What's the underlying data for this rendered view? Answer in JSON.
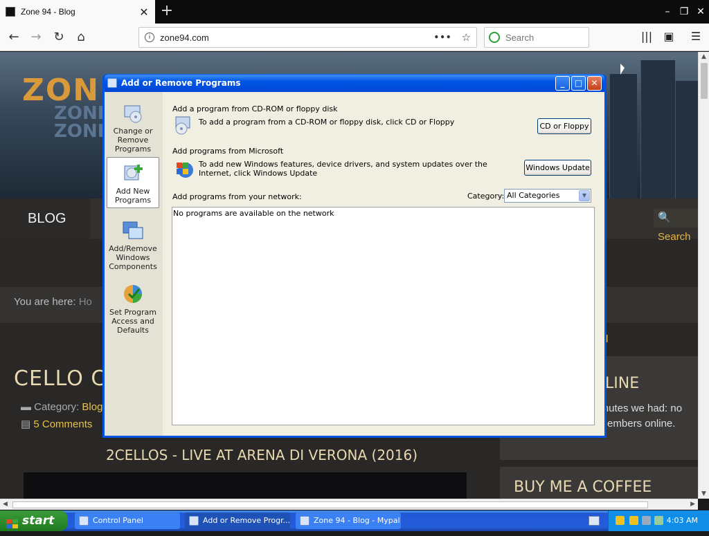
{
  "browser": {
    "tab_title": "Zone 94 - Blog",
    "url": "zone94.com",
    "search_placeholder": "Search"
  },
  "webpage": {
    "nav_blog": "BLOG",
    "nav_search": "Search",
    "breadcrumb_label": "You are here:",
    "breadcrumb_home": "Ho",
    "post_title": "CELLO CR",
    "category_label": "Category:",
    "category_link": "Blog",
    "comments": "5 Comments",
    "subheading": "2CELLOS - LIVE AT ARENA DI VERONA (2016)",
    "sidebar_fragment": "d",
    "sidebar_title": "LINE",
    "sidebar_text": "minutes we had: no members online.",
    "sidebar_coffee": "BUY ME A COFFEE",
    "logo_text": "ZON",
    "logo_sub": "ZONE ZONE"
  },
  "dialog": {
    "title": "Add or Remove Programs",
    "left_pane": [
      {
        "label": "Change or Remove Programs"
      },
      {
        "label": "Add New Programs"
      },
      {
        "label": "Add/Remove Windows Components"
      },
      {
        "label": "Set Program Access and Defaults"
      }
    ],
    "cdrom_heading": "Add a program from CD-ROM or floppy disk",
    "cdrom_desc": "To add a program from a CD-ROM or floppy disk, click CD or Floppy",
    "cdrom_button": "CD or Floppy",
    "ms_heading": "Add programs from Microsoft",
    "ms_desc": "To add new Windows features, device drivers, and system updates over the Internet, click Windows Update",
    "ms_button": "Windows Update",
    "network_heading": "Add programs from your network:",
    "category_label": "Category:",
    "category_value": "All Categories",
    "network_empty": "No programs are available on the network"
  },
  "taskbar": {
    "start": "start",
    "tasks": [
      {
        "label": "Control Panel"
      },
      {
        "label": "Add or Remove Progr..."
      },
      {
        "label": "Zone 94 - Blog - Mypal"
      }
    ],
    "clock": "4:03 AM"
  }
}
